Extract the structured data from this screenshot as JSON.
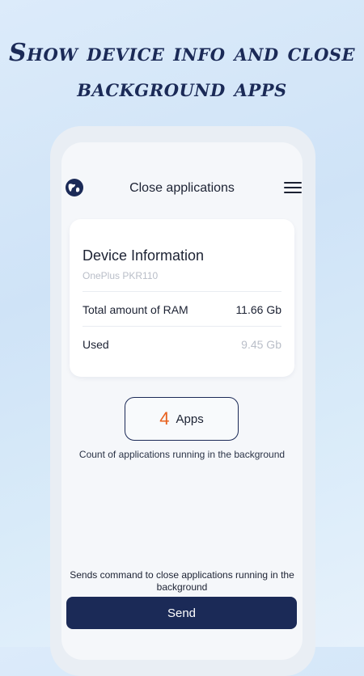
{
  "promo": {
    "headline_line1": "Show device info and close",
    "headline_line2": "background apps"
  },
  "topbar": {
    "title": "Close applications",
    "left_icon": "globe-icon",
    "right_icon": "menu-icon"
  },
  "device_card": {
    "title": "Device Information",
    "model": "OnePlus PKR110",
    "rows": [
      {
        "label": "Total amount of RAM",
        "value": "11.66 Gb"
      },
      {
        "label": "Used",
        "value": "9.45 Gb"
      }
    ]
  },
  "apps": {
    "count": "4",
    "label": "Apps",
    "caption": "Count of applications running in the background"
  },
  "send": {
    "caption": "Sends command to close applications running in the background",
    "button_label": "Send"
  },
  "colors": {
    "brand_navy": "#1b2a57",
    "accent_orange": "#e8611e",
    "muted_text": "#b9bec8"
  }
}
